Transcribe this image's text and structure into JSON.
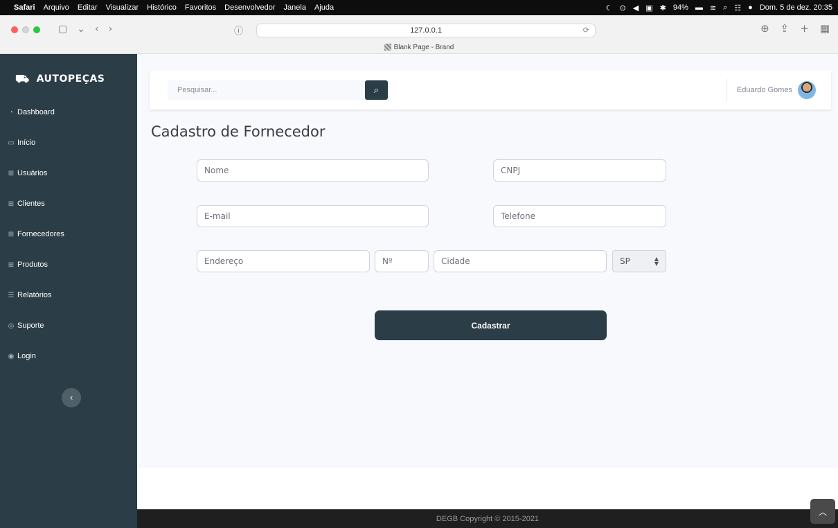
{
  "menubar": {
    "apple": "",
    "items": [
      "Safari",
      "Arquivo",
      "Editar",
      "Visualizar",
      "Histórico",
      "Favoritos",
      "Desenvolvedor",
      "Janela",
      "Ajuda"
    ],
    "battery": "94%",
    "clock": "Dom. 5 de dez.  20:35"
  },
  "browser": {
    "url": "127.0.0.1",
    "tab_title": "Blank Page - Brand"
  },
  "sidebar": {
    "brand": "AUTOPEÇAS",
    "items": [
      {
        "icon": "dashboard-icon",
        "glyph": "◔",
        "label": "Dashboard"
      },
      {
        "icon": "home-icon",
        "glyph": "▭",
        "label": "Início"
      },
      {
        "icon": "table-icon",
        "glyph": "⊞",
        "label": "Usuários"
      },
      {
        "icon": "table-icon",
        "glyph": "⊞",
        "label": "Clientes"
      },
      {
        "icon": "table-icon",
        "glyph": "⊞",
        "label": "Fornecedores"
      },
      {
        "icon": "table-icon",
        "glyph": "⊞",
        "label": "Produtos"
      },
      {
        "icon": "list-icon",
        "glyph": "☰",
        "label": "Relatórios"
      },
      {
        "icon": "support-icon",
        "glyph": "◎",
        "label": "Suporte"
      },
      {
        "icon": "user-icon",
        "glyph": "◉",
        "label": "Login"
      }
    ]
  },
  "topbar": {
    "search_placeholder": "Pesquisar...",
    "user_name": "Eduardo Gomes"
  },
  "page": {
    "title": "Cadastro de Fornecedor"
  },
  "form": {
    "nome_placeholder": "Nome",
    "cnpj_placeholder": "CNPJ",
    "email_placeholder": "E-mail",
    "telefone_placeholder": "Telefone",
    "endereco_placeholder": "Endereço",
    "numero_placeholder": "Nº",
    "cidade_placeholder": "Cidade",
    "estado_value": "SP",
    "submit_label": "Cadastrar"
  },
  "footer": {
    "copyright": "DEGB Copyright © 2015-2021"
  }
}
